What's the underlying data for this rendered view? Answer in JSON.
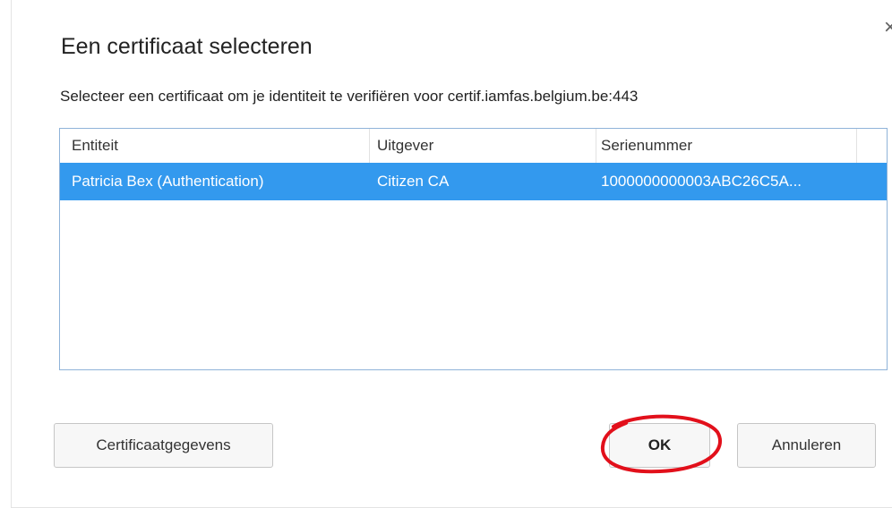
{
  "dialog": {
    "title": "Een certificaat selecteren",
    "close_label": "×",
    "description": "Selecteer een certificaat om je identiteit te verifiëren voor certif.iamfas.belgium.be:443"
  },
  "table": {
    "columns": [
      "Entiteit",
      "Uitgever",
      "Serienummer"
    ],
    "rows": [
      {
        "entity": "Patricia Bex (Authentication)",
        "issuer": "Citizen CA",
        "serial": "1000000000003ABC26C5A..."
      }
    ],
    "selected_row_color": "#3399ee"
  },
  "buttons": {
    "details_label": "Certificaatgegevens",
    "ok_label": "OK",
    "cancel_label": "Annuleren"
  },
  "annotation": {
    "color": "#e2101b"
  }
}
